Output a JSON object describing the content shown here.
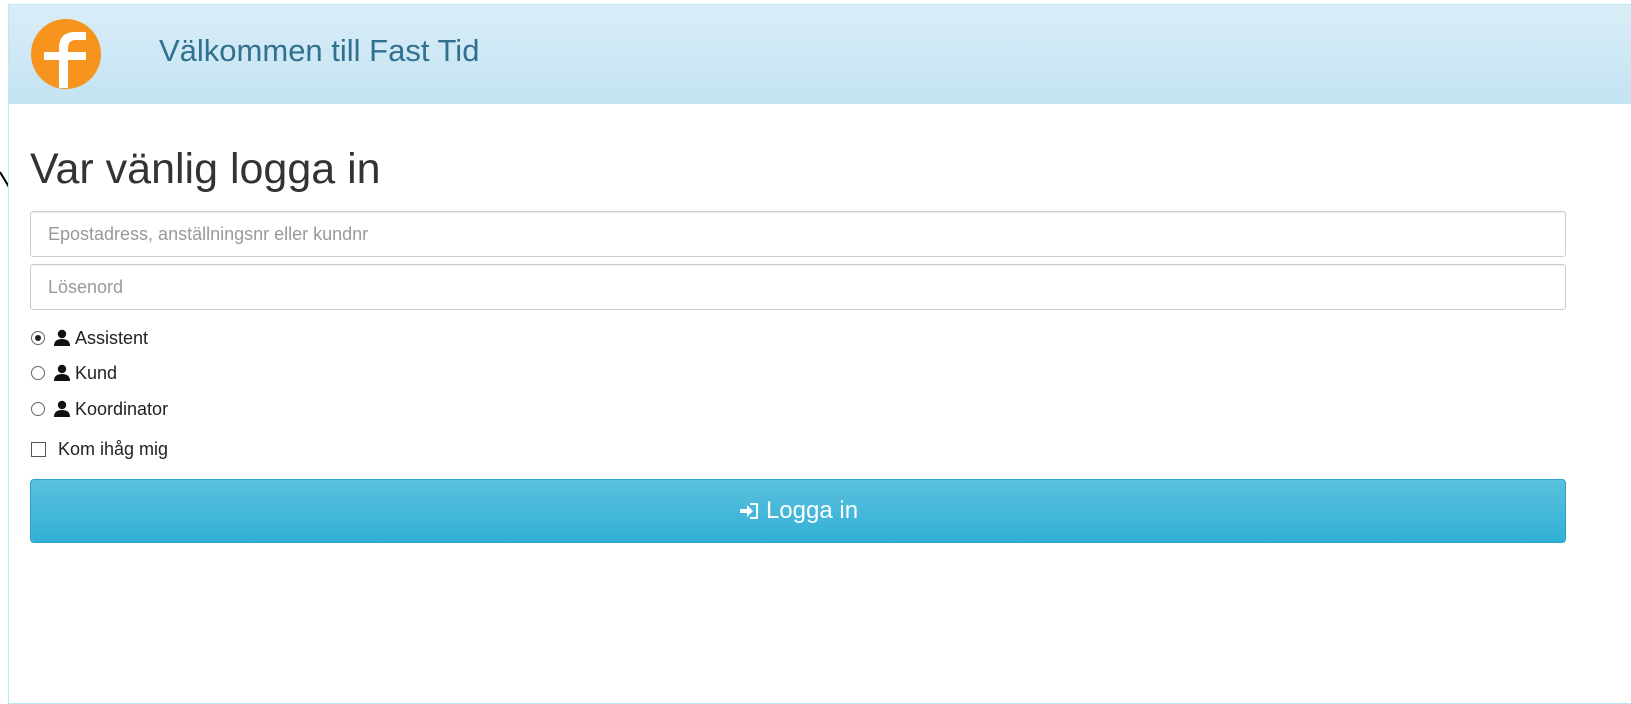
{
  "header": {
    "title": "Välkommen till Fast Tid",
    "logo_icon": "fast-tid-logo-icon",
    "logo_color": "#f7941e"
  },
  "main": {
    "heading": "Var vänlig logga in"
  },
  "form": {
    "email_placeholder": "Epostadress, anställningsnr eller kundnr",
    "email_value": "",
    "password_placeholder": "Lösenord",
    "password_value": "",
    "roles": [
      {
        "label": "Assistent",
        "icon": "user-icon",
        "selected": true
      },
      {
        "label": "Kund",
        "icon": "user-icon",
        "selected": false
      },
      {
        "label": "Koordinator",
        "icon": "user-icon",
        "selected": false
      }
    ],
    "remember_label": "Kom ihåg mig",
    "remember_checked": false,
    "submit_label": "Logga in",
    "submit_icon": "log-in-icon"
  },
  "colors": {
    "header_bg": "#d9edf7",
    "header_text": "#31708f",
    "button_bg": "#5bc0de"
  }
}
